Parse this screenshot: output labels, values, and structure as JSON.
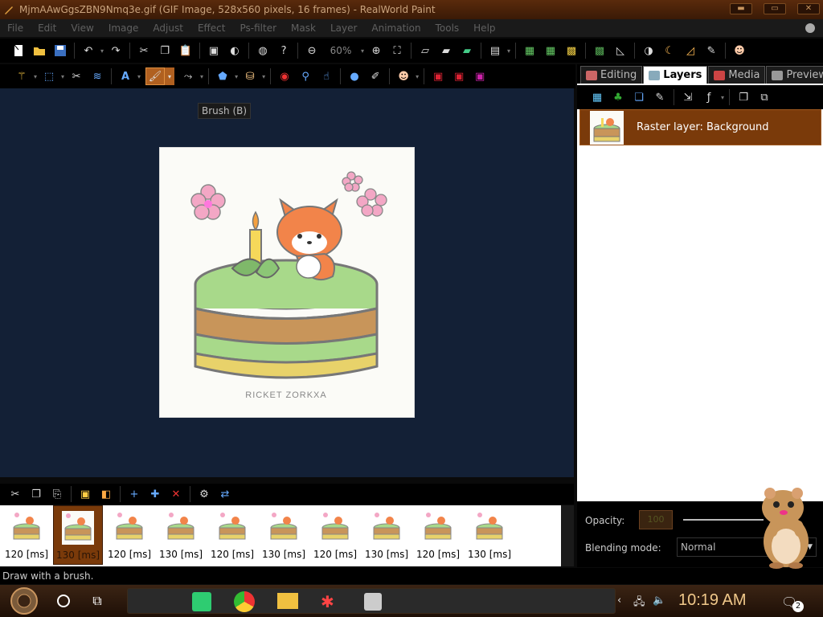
{
  "window": {
    "title": "MjmAAwGgsZBN9Nmq3e.gif (GIF Image, 528x560 pixels, 16 frames) - RealWorld Paint",
    "controls": [
      "minimize",
      "maximize",
      "close"
    ]
  },
  "menu": [
    "File",
    "Edit",
    "View",
    "Image",
    "Adjust",
    "Effect",
    "Ps-filter",
    "Mask",
    "Layer",
    "Animation",
    "Tools",
    "Help"
  ],
  "toolbar": {
    "zoom": "60%"
  },
  "tooltip": "Brush (B)",
  "panel": {
    "tabs": [
      "Editing",
      "Layers",
      "Media",
      "Preview"
    ],
    "active_tab": "Layers",
    "layer_name": "Raster layer: Background",
    "opacity_label": "Opacity:",
    "opacity_value": "100",
    "blend_label": "Blending mode:",
    "blend_value": "Normal"
  },
  "image": {
    "watermark": "RICKET ZORKXA"
  },
  "frames": [
    {
      "label": "120 [ms]"
    },
    {
      "label": "130 [ms]"
    },
    {
      "label": "120 [ms]"
    },
    {
      "label": "130 [ms]"
    },
    {
      "label": "120 [ms]"
    },
    {
      "label": "130 [ms]"
    },
    {
      "label": "120 [ms]"
    },
    {
      "label": "130 [ms]"
    },
    {
      "label": "120 [ms]"
    },
    {
      "label": "130 [ms]"
    }
  ],
  "selected_frame": 1,
  "status": "Draw with a brush.",
  "taskbar": {
    "clock": "10:19 AM",
    "notifications": "2"
  },
  "colors": {
    "accent": "#7a3a0a",
    "canvas_bg": "#132036",
    "title_text": "#caa47e",
    "clock": "#f0c88a"
  }
}
